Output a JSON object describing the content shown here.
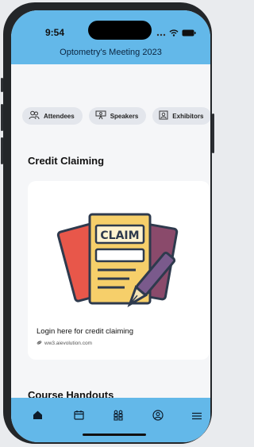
{
  "status_bar": {
    "time": "9:54"
  },
  "header": {
    "title": "Optometry's Meeting 2023"
  },
  "chips": [
    {
      "label": "Attendees",
      "icon": "attendees-icon"
    },
    {
      "label": "Speakers",
      "icon": "speakers-icon"
    },
    {
      "label": "Exhibitors",
      "icon": "exhibitors-icon"
    }
  ],
  "credit_section": {
    "title": "Credit Claiming",
    "card": {
      "art_text": "CLAIM",
      "caption": "Login here for credit claiming",
      "link": "ww3.aievolution.com"
    }
  },
  "handouts_section": {
    "title": "Course Handouts"
  },
  "tabbar": {
    "items": [
      "home-icon",
      "calendar-icon",
      "people-icon",
      "profile-icon",
      "menu-icon"
    ],
    "active": "home-icon"
  },
  "colors": {
    "accent": "#63b8e9",
    "background": "#f5f6f8",
    "chip": "#e3e6ec"
  }
}
